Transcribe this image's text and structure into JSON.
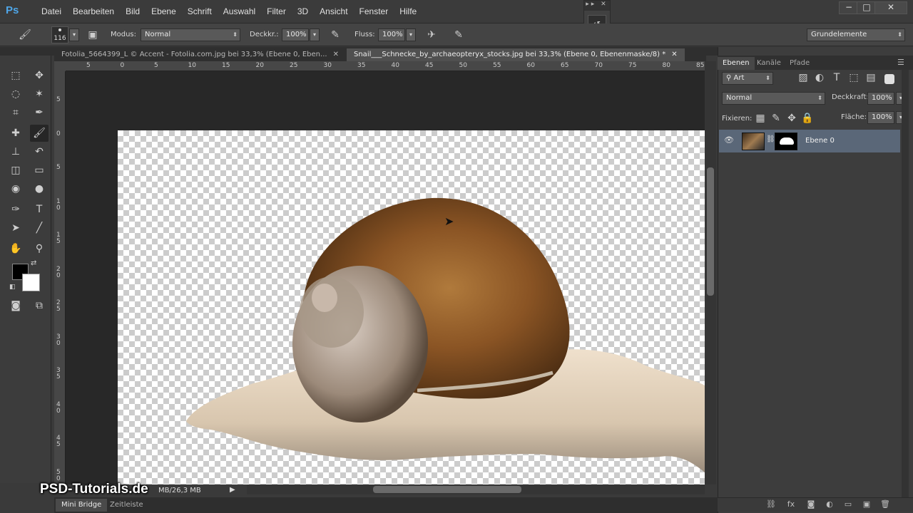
{
  "app": {
    "logo": "Ps"
  },
  "menu": [
    "Datei",
    "Bearbeiten",
    "Bild",
    "Ebene",
    "Schrift",
    "Auswahl",
    "Filter",
    "3D",
    "Ansicht",
    "Fenster",
    "Hilfe"
  ],
  "window_controls": {
    "minimize": "−",
    "restore": "□",
    "close": "✕"
  },
  "options": {
    "brush_size": "116",
    "mode_label": "Modus:",
    "mode_value": "Normal",
    "opacity_label": "Deckkr.:",
    "opacity_value": "100%",
    "flow_label": "Fluss:",
    "flow_value": "100%",
    "workspace": "Grundelemente"
  },
  "tabs": [
    {
      "label": "Fotolia_5664399_L © Accent - Fotolia.com.jpg bei 33,3% (Ebene 0, Eben...",
      "close": "✕"
    },
    {
      "label": "Snail___Schnecke_by_archaeopteryx_stocks.jpg bei 33,3% (Ebene 0, Ebenenmaske/8) *",
      "close": "✕"
    }
  ],
  "ruler_h": [
    "5",
    "0",
    "5",
    "10",
    "15",
    "20",
    "25",
    "30",
    "35",
    "40",
    "45",
    "50",
    "55",
    "60",
    "65",
    "70",
    "75",
    "80",
    "85"
  ],
  "ruler_v": [
    "5",
    "0",
    "5",
    "1 0",
    "1 5",
    "2 0",
    "2 5",
    "3 0",
    "3 5",
    "4 0",
    "4 5",
    "5 0"
  ],
  "status": {
    "doc_size": "MB/26,3 MB",
    "watermark": "PSD-Tutorials.de"
  },
  "bottom_tabs": [
    "Mini Bridge",
    "Zeitleiste"
  ],
  "layers_panel": {
    "tabs": [
      "Ebenen",
      "Kanäle",
      "Pfade"
    ],
    "filter_kind": "Art",
    "blend_mode": "Normal",
    "opacity_label": "Deckkraft:",
    "opacity_value": "100%",
    "lock_label": "Fixieren:",
    "fill_label": "Fläche:",
    "fill_value": "100%",
    "layers": [
      {
        "name": "Ebene 0"
      }
    ]
  },
  "colors": {
    "foreground": "#000000",
    "background": "#ffffff",
    "accent": "#4fa6e8",
    "layer_selected": "#5a6778"
  }
}
